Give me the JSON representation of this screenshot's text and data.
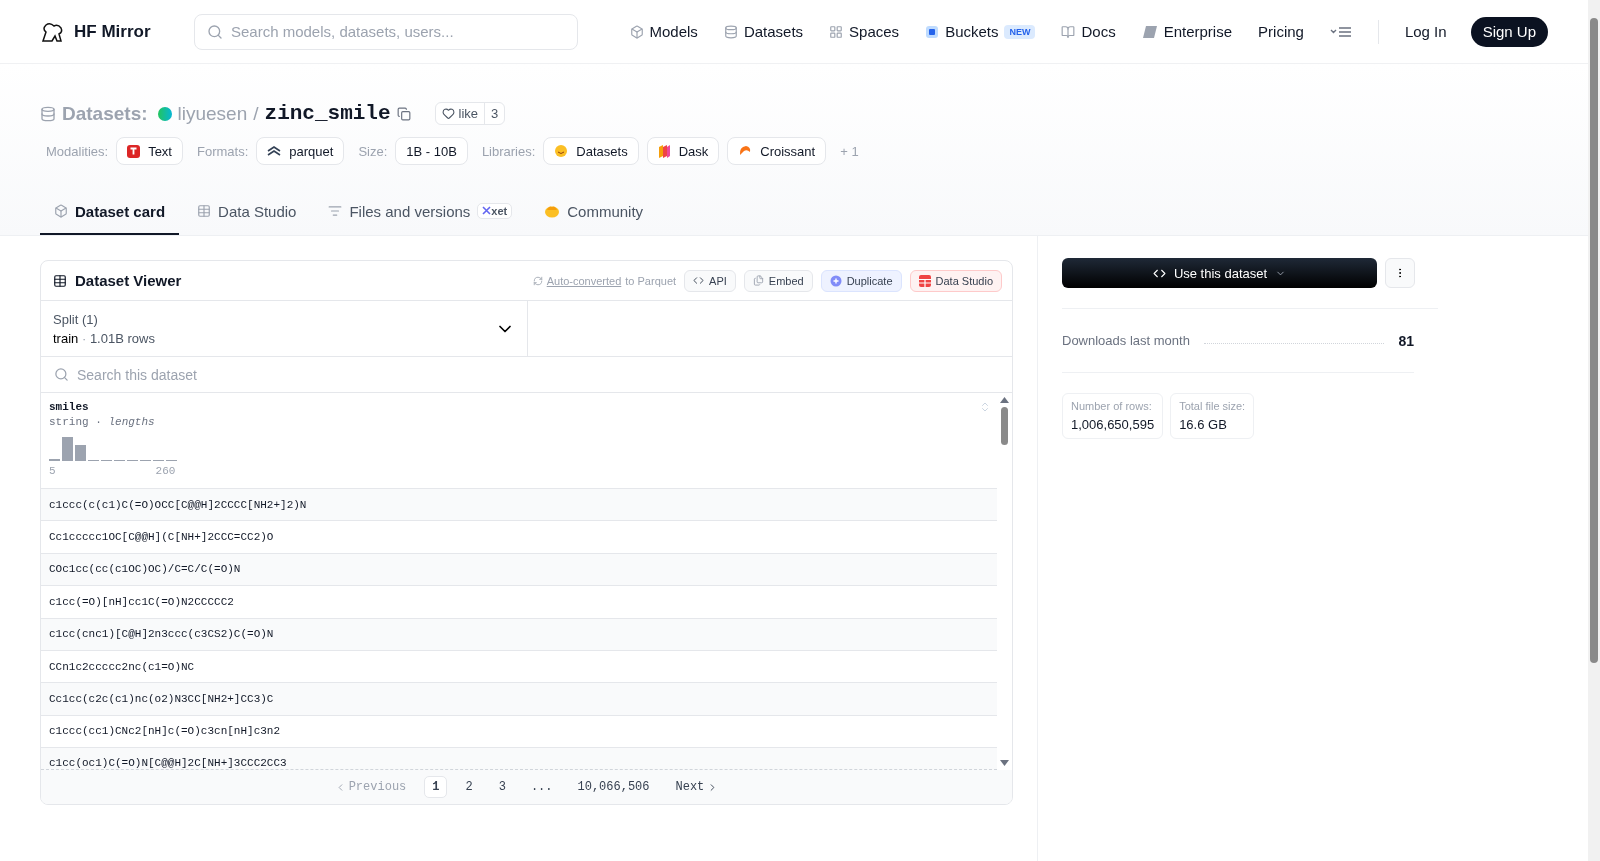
{
  "header": {
    "brand": "HF Mirror",
    "search_placeholder": "Search models, datasets, users...",
    "nav": [
      {
        "label": "Models",
        "kind": "models"
      },
      {
        "label": "Datasets",
        "kind": "datasets"
      },
      {
        "label": "Spaces",
        "kind": "spaces"
      },
      {
        "label": "Buckets",
        "kind": "buckets",
        "badge": "NEW"
      },
      {
        "label": "Docs",
        "kind": "docs"
      },
      {
        "label": "Enterprise",
        "kind": "enterprise"
      },
      {
        "label": "Pricing",
        "kind": "plain"
      }
    ],
    "login": "Log In",
    "signup": "Sign Up"
  },
  "repo": {
    "type_label": "Datasets:",
    "owner": "liyuesen",
    "separator": "/",
    "name": "zinc_smile",
    "like_label": "like",
    "like_count": "3"
  },
  "tag_groups": [
    {
      "label": "Modalities:",
      "chips": [
        {
          "label": "Text",
          "kind": "text"
        }
      ]
    },
    {
      "label": "Formats:",
      "chips": [
        {
          "label": "parquet",
          "kind": "parquet"
        }
      ]
    },
    {
      "label": "Size:",
      "chips": [
        {
          "label": "1B - 10B",
          "kind": "plain"
        }
      ]
    },
    {
      "label": "Libraries:",
      "chips": [
        {
          "label": "Datasets",
          "kind": "hf"
        },
        {
          "label": "Dask",
          "kind": "dask"
        },
        {
          "label": "Croissant",
          "kind": "croissant"
        }
      ]
    }
  ],
  "more_tags": "+ 1",
  "tabs": [
    {
      "label": "Dataset card",
      "kind": "card",
      "selected": true
    },
    {
      "label": "Data Studio",
      "kind": "studio",
      "selected": false
    },
    {
      "label": "Files and versions",
      "kind": "files",
      "selected": false,
      "badge": "xet"
    },
    {
      "label": "Community",
      "kind": "community",
      "selected": false
    }
  ],
  "viewer": {
    "title": "Dataset Viewer",
    "converted_link": "Auto-converted",
    "converted_rest": "to Parquet",
    "actions": [
      {
        "label": "API",
        "kind": "api"
      },
      {
        "label": "Embed",
        "kind": "embed"
      },
      {
        "label": "Duplicate",
        "kind": "duplicate"
      },
      {
        "label": "Data Studio",
        "kind": "studio"
      }
    ],
    "split_label": "Split (1)",
    "split_name": "train",
    "split_dot": "·",
    "split_rows": "1.01B rows",
    "search_placeholder": "Search this dataset",
    "column": {
      "name": "smiles",
      "type": "string",
      "type_dot": "·",
      "stat": "lengths",
      "min": "5",
      "max": "260"
    },
    "rows": [
      "c1ccc(c(c1)C(=O)OCC[C@@H]2CCCC[NH2+]2)N",
      "Cc1ccccc1OC[C@@H](C[NH+]2CCC=CC2)O",
      "COc1cc(cc(c1OC)OC)/C=C/C(=O)N",
      "c1cc(=O)[nH]cc1C(=O)N2CCCCC2",
      "c1cc(cnc1)[C@H]2n3ccc(c3CS2)C(=O)N",
      "CCn1c2ccccc2nc(c1=O)NC",
      "Cc1cc(c2c(c1)nc(o2)N3CC[NH2+]CC3)C",
      "c1ccc(cc1)CNc2[nH]c(=O)c3cn[nH]c3n2",
      "c1cc(oc1)C(=O)N[C@@H]2C[NH+]3CCC2CC3"
    ],
    "pagination": {
      "previous": "Previous",
      "pages": [
        {
          "label": "1",
          "selected": true
        },
        {
          "label": "2",
          "selected": false
        },
        {
          "label": "3",
          "selected": false
        }
      ],
      "ellipsis": "...",
      "last": "10,066,506",
      "next": "Next"
    }
  },
  "sidebar": {
    "use_button": "Use this dataset",
    "downloads_label": "Downloads last month",
    "downloads_value": "81",
    "stats": [
      {
        "label": "Number of rows:",
        "value": "1,006,650,595"
      },
      {
        "label": "Total file size:",
        "value": "16.6 GB"
      }
    ]
  }
}
